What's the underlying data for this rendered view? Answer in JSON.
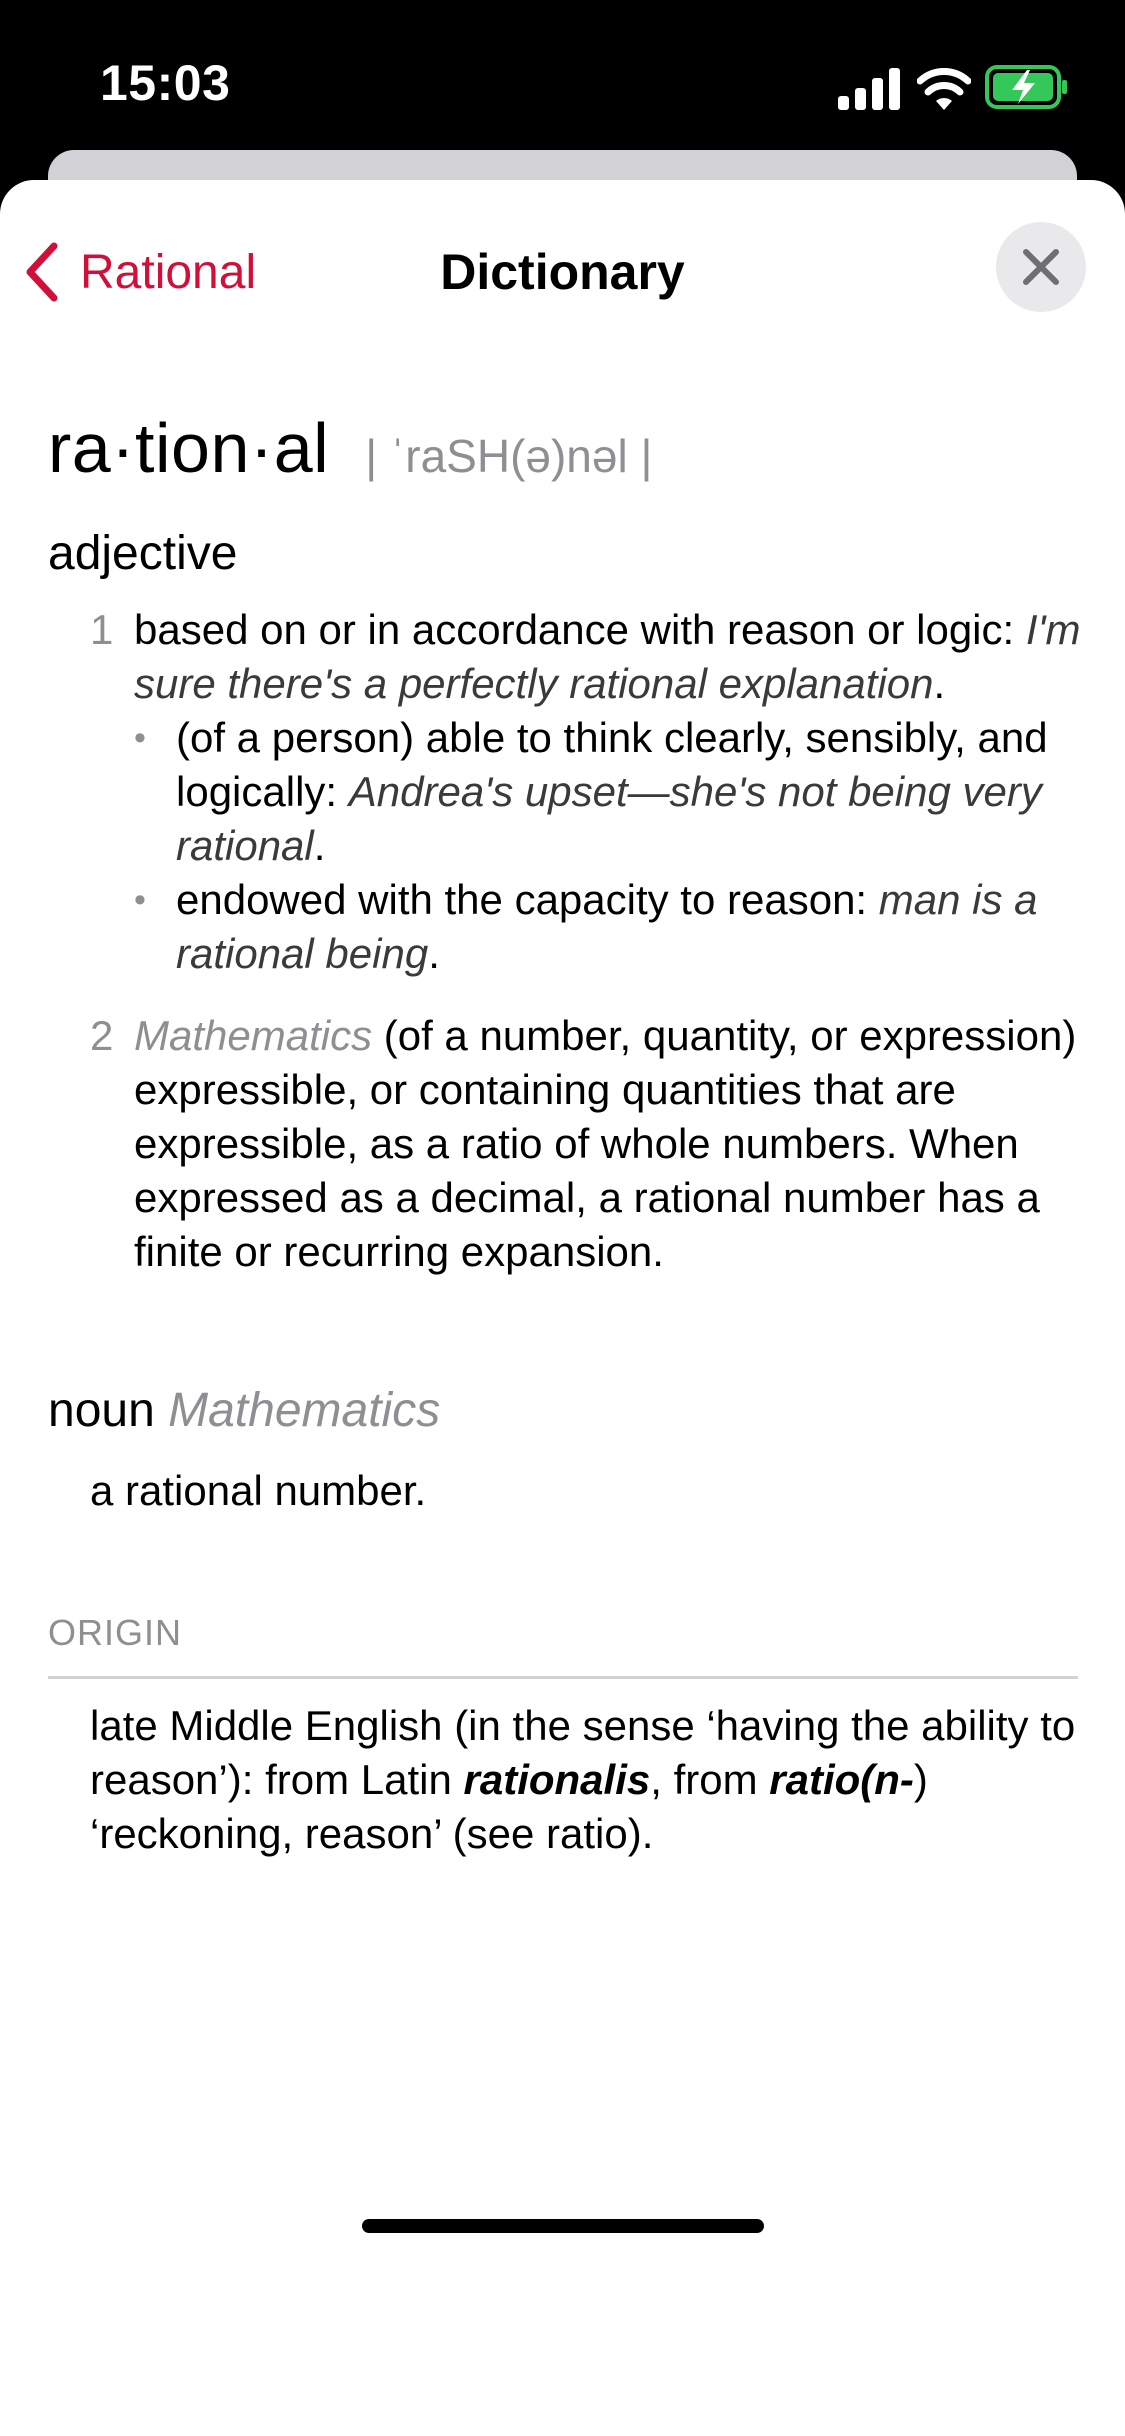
{
  "status_bar": {
    "time": "15:03",
    "icons": [
      "signal-icon",
      "wifi-icon",
      "battery-charging-icon"
    ],
    "battery_color": "#34c759"
  },
  "nav": {
    "back_label": "Rational",
    "title": "Dictionary",
    "accent_color": "#d0103a",
    "icons": [
      "chevron-left-icon",
      "close-icon"
    ]
  },
  "entry": {
    "headword": "ra·tion·al",
    "pronunciation": "| ˈraSH(ə)nəl |",
    "adjective": {
      "pos": "adjective",
      "sense1": {
        "num": "1",
        "definition": "based on or in accordance with reason or logic:",
        "example": "I'm sure there's a perfectly rational explanation",
        "subsenses": [
          {
            "bullet": "•",
            "definition": "(of a person) able to think clearly, sensibly, and logically:",
            "example": "Andrea's upset—she's not being very rational"
          },
          {
            "bullet": "•",
            "definition": "endowed with the capacity to reason:",
            "example": "man is a rational being"
          }
        ]
      },
      "sense2": {
        "num": "2",
        "domain": "Mathematics",
        "definition": "(of a number, quantity, or expression) expressible, or containing quantities that are expressible, as a ratio of whole numbers. When expressed as a decimal, a rational number has a finite or recurring expansion."
      }
    },
    "noun": {
      "pos": "noun",
      "domain": "Mathematics",
      "definition": "a rational number."
    },
    "origin": {
      "label": "ORIGIN",
      "part1": "late Middle English (in the sense ‘having the ability to reason’): from Latin",
      "term1": "rationalis",
      "part2": ", from",
      "term2": "ratio(n-",
      "part3": ") ‘reckoning, reason’ (see ratio)."
    }
  }
}
